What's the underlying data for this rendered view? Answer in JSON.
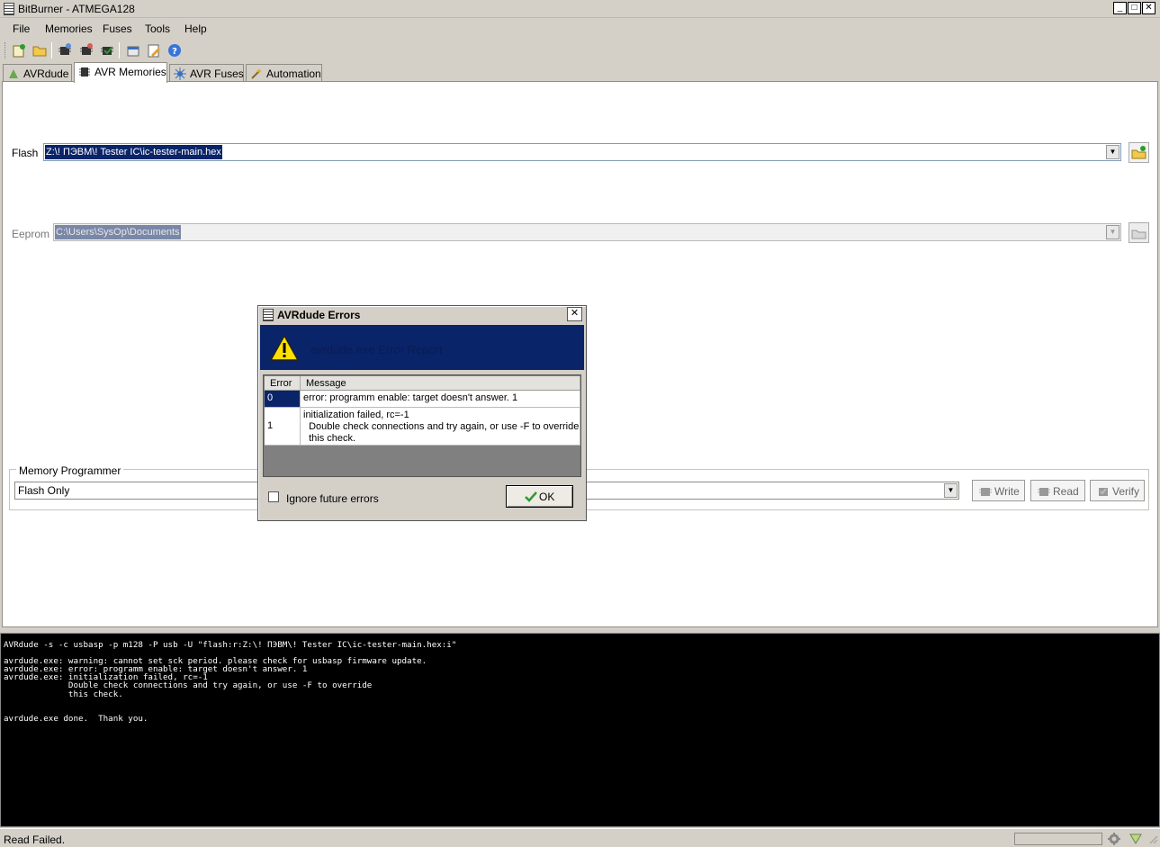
{
  "window": {
    "title": "BitBurner - ATMEGA128",
    "min_glyph": "_",
    "max_glyph": "□",
    "close_glyph": "✕"
  },
  "menu": {
    "file": "File",
    "memories": "Memories",
    "fuses": "Fuses",
    "tools": "Tools",
    "help": "Help"
  },
  "tabs": {
    "avrdude": "AVRdude",
    "avr_memories": "AVR Memories",
    "avr_fuses": "AVR Fuses",
    "automation": "Automation"
  },
  "memories": {
    "flash_label": "Flash",
    "flash_path": "Z:\\! ПЭВМ\\! Tester IC\\ic-tester-main.hex",
    "eeprom_label": "Eeprom",
    "eeprom_path": "C:\\Users\\SysOp\\Documents"
  },
  "programmer": {
    "legend": "Memory Programmer",
    "mode": "Flash Only",
    "write": "Write",
    "read": "Read",
    "verify": "Verify"
  },
  "console": {
    "lines": [
      "AVRdude -s -c usbasp -p m128 -P usb -U \"flash:r:Z:\\! ПЭВМ\\! Tester IC\\ic-tester-main.hex:i\"",
      "",
      "avrdude.exe: warning: cannot set sck period. please check for usbasp firmware update.",
      "avrdude.exe: error: programm enable: target doesn't answer. 1",
      "avrdude.exe: initialization failed, rc=-1",
      "             Double check connections and try again, or use -F to override",
      "             this check.",
      "",
      "",
      "avrdude.exe done.  Thank you."
    ]
  },
  "status": {
    "text": "Read Failed."
  },
  "dialog": {
    "title": "AVRdude Errors",
    "close_glyph": "✕",
    "header": "avrdude.exe Error Report",
    "col_error": "Error",
    "col_message": "Message",
    "rows": [
      {
        "error": "0",
        "message": "error: programm enable: target doesn't answer. 1"
      },
      {
        "error": "1",
        "message_lines": [
          "initialization failed, rc=-1",
          "  Double check connections and try again, or use -F to override",
          "  this check."
        ]
      }
    ],
    "ignore_label": "Ignore future errors",
    "ignore_checked": false,
    "ok": "OK"
  },
  "colors": {
    "selection": "#0a246a",
    "console_bg": "#000000",
    "dialog_header": "#0a246a"
  }
}
